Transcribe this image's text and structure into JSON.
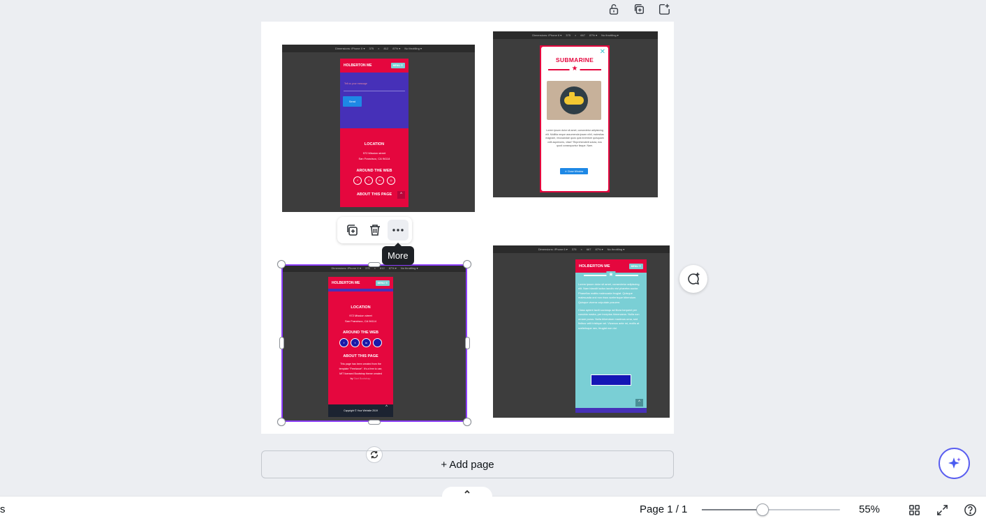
{
  "page_toolbar": {
    "lock": "lock-icon",
    "duplicate": "duplicate-page-icon",
    "add": "add-page-icon"
  },
  "shots": {
    "one": {
      "bar_items": [
        "Dimensions: iPhone X ▾",
        "375",
        "×",
        "812",
        "87% ▾",
        "No throttling ▾"
      ],
      "brand": "HOLBERTON ME",
      "menu": "MENU ☰",
      "message_placeholder": "Tell us your message",
      "send": "Send",
      "location_title": "LOCATION",
      "address1": "972 Mission street",
      "address2": "San Francisco, CA 94114",
      "around_title": "AROUND THE WEB",
      "social": [
        "f",
        "t",
        "in",
        "◎"
      ],
      "about_title": "ABOUT THIS PAGE"
    },
    "two": {
      "bar_items": [
        "Dimensions: iPhone 6 ▾",
        "375",
        "×",
        "667",
        "87% ▾",
        "No throttling ▾"
      ],
      "title": "SUBMARINE",
      "close": "✕",
      "body": "Lorem ipsum dolor sit amet, consectetur adipisicing elit. Mollitia neque assumenda ipsam nihil, molestias magnam, recusandae quos quis inventore quisquam velit asperiores, vitae? Reprehenderit soluta, eos quod consequuntur itaque. Nam.",
      "close_window": "✕ Close Window"
    },
    "three": {
      "bar_items": [
        "Dimensions: iPhone X ▾",
        "375",
        "×",
        "812",
        "87% ▾",
        "No throttling ▾"
      ],
      "brand": "HOLBERTON ME",
      "menu": "MENU ☰",
      "location_title": "LOCATION",
      "address1": "972 Mission street",
      "address2": "San Francisco, CA 94114",
      "around_title": "AROUND THE WEB",
      "social": [
        "f",
        "t",
        "in",
        ""
      ],
      "about_title": "ABOUT THIS PAGE",
      "about_text1": "This page has been created from the",
      "about_text2": "template \"Freelance\". It's a free to use,",
      "about_text3": "MIT licensed Bootstrap theme created",
      "about_text4_pre": "by",
      "about_link": "Start Bootstrap.",
      "copyright": "Copyright © Your Website 2019"
    },
    "four": {
      "bar_items": [
        "Dimensions: iPhone 6 ▾",
        "375",
        "×",
        "667",
        "87% ▾",
        "No throttling ▾"
      ],
      "brand": "HOLBERTON ME",
      "menu": "MENU ☰",
      "para1": "Lorem ipsum dolor sit amet, consectetur adipiscing elit. Nam blandit luctus iaculis nisl pharetra auctor. Phasellus mattis malesuada feugiat. Quisque malesuada orci non risus scelerisque bibendum. Quisque viverra vulputate posuere.",
      "para2": "Class aptent taciti sociosqu ad litora torquent per conubia nostra, per inceptos himenaeos. Nulla non ornare purus. Nulla bibendum maximus urna, sed finibus velit tristique vel. Vivamus ante mi, mollis at scelerisque nec, feugiat non dui."
    }
  },
  "element_toolbar": {
    "duplicate": "duplicate-icon",
    "delete": "trash-icon",
    "more": "more-icon"
  },
  "tooltip": "More",
  "add_page": "+ Add page",
  "footer": {
    "left_fragment": "s",
    "page_indicator": "Page 1 / 1",
    "zoom": "55%",
    "zoom_fraction": 0.44
  },
  "colors": {
    "selection": "#8b3dff",
    "red": "#e5073e",
    "purple": "#4630b8",
    "teal": "#7acfd5",
    "ai_accent": "#5a5ef0"
  }
}
